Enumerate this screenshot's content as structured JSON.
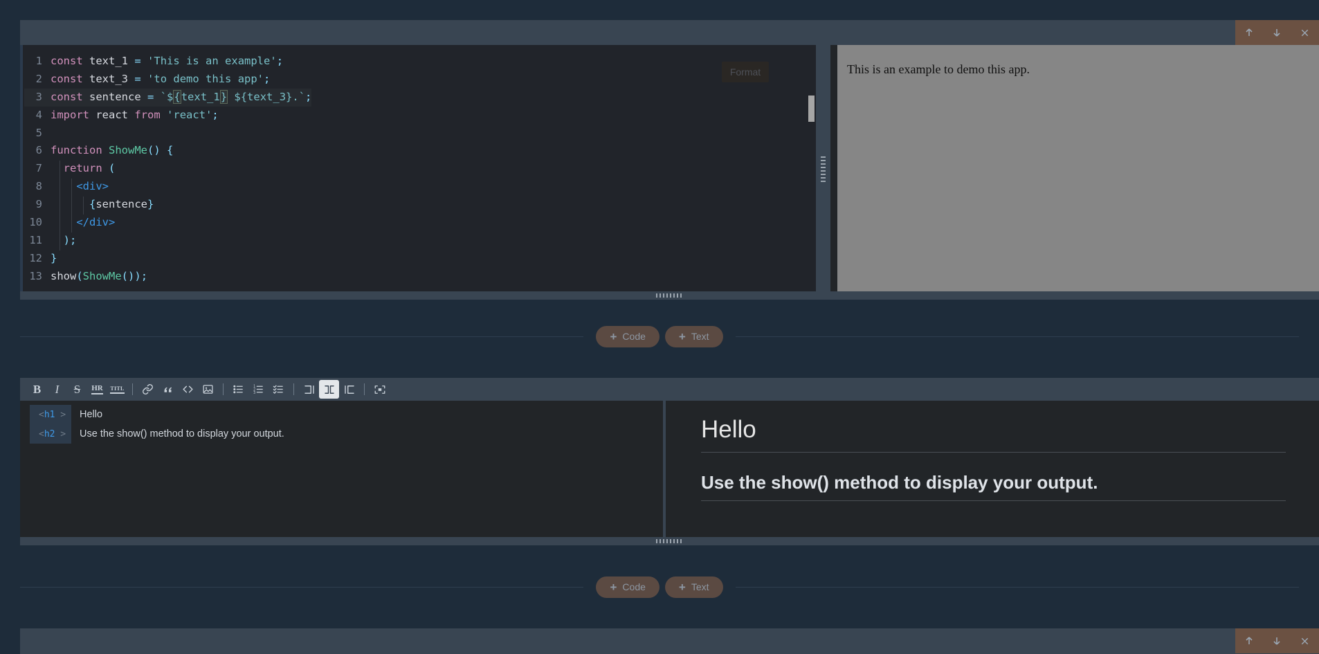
{
  "window": {
    "actions": [
      {
        "name": "move-up",
        "icon": "arrow-up-icon",
        "label": "Move cell up"
      },
      {
        "name": "move-down",
        "icon": "arrow-down-icon",
        "label": "Move cell down"
      },
      {
        "name": "delete",
        "icon": "close-icon",
        "label": "Delete cell"
      }
    ]
  },
  "code_cell": {
    "format_button_label": "Format",
    "language": "javascript",
    "lines": [
      {
        "num": "1",
        "tokens": [
          {
            "t": "const",
            "c": "t-kw"
          },
          {
            "t": " ",
            "c": "t-plain"
          },
          {
            "t": "text_1",
            "c": "t-var"
          },
          {
            "t": " ",
            "c": "t-plain"
          },
          {
            "t": "=",
            "c": "t-op"
          },
          {
            "t": " ",
            "c": "t-plain"
          },
          {
            "t": "'This is an example'",
            "c": "t-str"
          },
          {
            "t": ";",
            "c": "t-punc"
          }
        ]
      },
      {
        "num": "2",
        "tokens": [
          {
            "t": "const",
            "c": "t-kw"
          },
          {
            "t": " ",
            "c": "t-plain"
          },
          {
            "t": "text_3",
            "c": "t-var"
          },
          {
            "t": " ",
            "c": "t-plain"
          },
          {
            "t": "=",
            "c": "t-op"
          },
          {
            "t": " ",
            "c": "t-plain"
          },
          {
            "t": "'to demo this app'",
            "c": "t-str"
          },
          {
            "t": ";",
            "c": "t-punc"
          }
        ]
      },
      {
        "num": "3",
        "highlight": true,
        "tokens": [
          {
            "t": "const",
            "c": "t-kw"
          },
          {
            "t": " ",
            "c": "t-plain"
          },
          {
            "t": "sentence",
            "c": "t-var"
          },
          {
            "t": " ",
            "c": "t-plain"
          },
          {
            "t": "=",
            "c": "t-op"
          },
          {
            "t": " ",
            "c": "t-plain"
          },
          {
            "t": "`$",
            "c": "t-str"
          },
          {
            "t": "{",
            "c": "t-str t-box"
          },
          {
            "t": "text_1",
            "c": "t-str"
          },
          {
            "t": "}",
            "c": "t-str t-box"
          },
          {
            "t": " ${text_3}.`",
            "c": "t-str"
          },
          {
            "t": ";",
            "c": "t-punc"
          }
        ]
      },
      {
        "num": "4",
        "tokens": [
          {
            "t": "import",
            "c": "t-kw"
          },
          {
            "t": " ",
            "c": "t-plain"
          },
          {
            "t": "react",
            "c": "t-var"
          },
          {
            "t": " ",
            "c": "t-plain"
          },
          {
            "t": "from",
            "c": "t-kw"
          },
          {
            "t": " ",
            "c": "t-plain"
          },
          {
            "t": "'react'",
            "c": "t-str"
          },
          {
            "t": ";",
            "c": "t-punc"
          }
        ]
      },
      {
        "num": "5",
        "tokens": []
      },
      {
        "num": "6",
        "tokens": [
          {
            "t": "function",
            "c": "t-kw"
          },
          {
            "t": " ",
            "c": "t-plain"
          },
          {
            "t": "ShowMe",
            "c": "t-fn"
          },
          {
            "t": "()",
            "c": "t-punc"
          },
          {
            "t": " ",
            "c": "t-plain"
          },
          {
            "t": "{",
            "c": "t-punc"
          }
        ]
      },
      {
        "num": "7",
        "tokens": [
          {
            "t": "  ",
            "c": "t-plain"
          },
          {
            "t": "return",
            "c": "t-kw"
          },
          {
            "t": " ",
            "c": "t-plain"
          },
          {
            "t": "(",
            "c": "t-punc"
          }
        ]
      },
      {
        "num": "8",
        "tokens": [
          {
            "t": "    ",
            "c": "t-plain"
          },
          {
            "t": "<div>",
            "c": "t-tag"
          }
        ]
      },
      {
        "num": "9",
        "tokens": [
          {
            "t": "      ",
            "c": "t-plain"
          },
          {
            "t": "{",
            "c": "t-punc"
          },
          {
            "t": "sentence",
            "c": "t-plain"
          },
          {
            "t": "}",
            "c": "t-punc"
          }
        ]
      },
      {
        "num": "10",
        "tokens": [
          {
            "t": "    ",
            "c": "t-plain"
          },
          {
            "t": "</div>",
            "c": "t-tag"
          }
        ]
      },
      {
        "num": "11",
        "tokens": [
          {
            "t": "  ",
            "c": "t-plain"
          },
          {
            "t": ");",
            "c": "t-punc"
          }
        ]
      },
      {
        "num": "12",
        "tokens": [
          {
            "t": "}",
            "c": "t-punc"
          }
        ]
      },
      {
        "num": "13",
        "tokens": [
          {
            "t": "show",
            "c": "t-plain"
          },
          {
            "t": "(",
            "c": "t-punc"
          },
          {
            "t": "ShowMe",
            "c": "t-fn"
          },
          {
            "t": "()",
            "c": "t-punc"
          },
          {
            "t": ")",
            "c": "t-punc"
          },
          {
            "t": ";",
            "c": "t-punc"
          }
        ]
      }
    ]
  },
  "output_pane": {
    "text": "This is an example to demo this app.",
    "background": "#868686"
  },
  "add_cell_bar": {
    "code_label": "Code",
    "text_label": "Text",
    "plus": "+"
  },
  "markdown_cell": {
    "toolbar_groups": [
      [
        {
          "name": "bold-icon",
          "glyph": "B",
          "title": "Bold"
        },
        {
          "name": "italic-icon",
          "glyph": "I",
          "title": "Italic"
        },
        {
          "name": "strikethrough-icon",
          "glyph": "S",
          "title": "Strikethrough"
        },
        {
          "name": "horizontal-rule-icon",
          "glyph": "HR",
          "title": "Horizontal rule"
        },
        {
          "name": "title-icon",
          "glyph": "TITL",
          "title": "Title"
        }
      ],
      [
        {
          "name": "link-icon",
          "glyph": "link",
          "title": "Link"
        },
        {
          "name": "quote-icon",
          "glyph": "quote",
          "title": "Blockquote"
        },
        {
          "name": "code-icon",
          "glyph": "code",
          "title": "Code"
        },
        {
          "name": "image-icon",
          "glyph": "image",
          "title": "Image"
        }
      ],
      [
        {
          "name": "bullet-list-icon",
          "glyph": "ul",
          "title": "Bullet list"
        },
        {
          "name": "ordered-list-icon",
          "glyph": "ol",
          "title": "Numbered list"
        },
        {
          "name": "task-list-icon",
          "glyph": "tl",
          "title": "Task list"
        }
      ],
      [
        {
          "name": "layout-editor-only-icon",
          "glyph": "l1",
          "title": "Editor only",
          "active": false
        },
        {
          "name": "layout-split-icon",
          "glyph": "l2",
          "title": "Split view",
          "active": true
        },
        {
          "name": "layout-preview-only-icon",
          "glyph": "l3",
          "title": "Preview only",
          "active": false
        }
      ],
      [
        {
          "name": "fullscreen-icon",
          "glyph": "fs",
          "title": "Fullscreen"
        }
      ]
    ],
    "source_lines": [
      {
        "tag": "h1",
        "text": "Hello"
      },
      {
        "tag": "h2",
        "text": "Use the show() method to display your output."
      }
    ],
    "preview": {
      "heading1": "Hello",
      "heading2": "Use the show() method to display your output."
    }
  },
  "theme": {
    "page_bg": "#1e2c3a",
    "cell_bg": "#222528",
    "bar_bg": "#394552",
    "accent_bar": "#6b5142",
    "add_button_bg": "#5b4a42",
    "muted_text": "#8d97a3"
  }
}
